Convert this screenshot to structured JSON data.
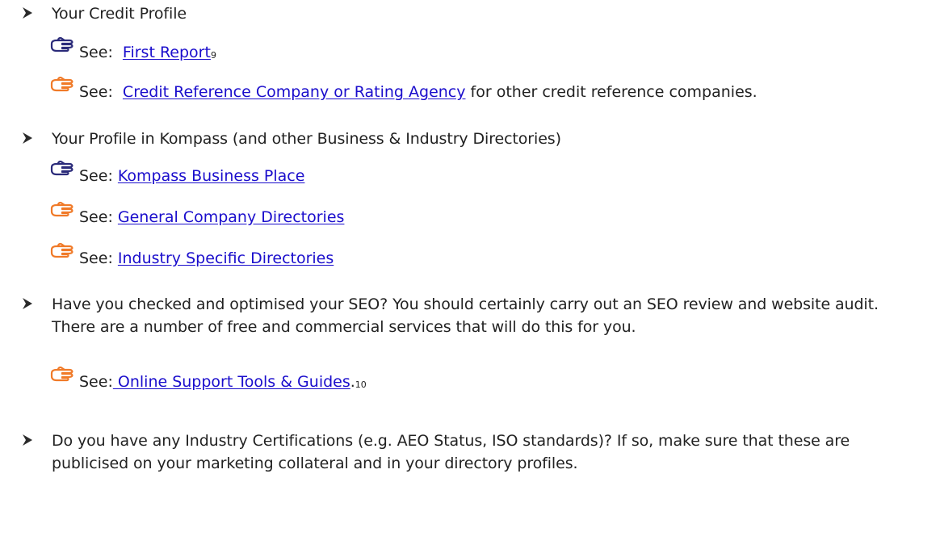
{
  "bullets": [
    {
      "text": "Your Credit Profile"
    },
    {
      "text": "Your Profile in Kompass (and other Business & Industry Directories)"
    },
    {
      "text": "Have you checked and optimised your SEO? You should certainly carry out an SEO review and website audit. There are a number of free and commercial services that will do this for you."
    },
    {
      "text": "Do you have any Industry Certifications (e.g. AEO Status, ISO standards)? If so, make sure that these are publicised on your marketing collateral and in your directory profiles."
    }
  ],
  "refs": [
    {
      "see": "See:  ",
      "link": "First Report",
      "sup": "9",
      "after": ""
    },
    {
      "see": "See:  ",
      "link": "Credit Reference Company or Rating Agency",
      "sup": "",
      "after": " for other credit reference companies."
    },
    {
      "see": "See: ",
      "link": "Kompass Business Place",
      "sup": "",
      "after": ""
    },
    {
      "see": "See: ",
      "link": "General Company Directories",
      "sup": "",
      "after": ""
    },
    {
      "see": "See: ",
      "link": "Industry Specific Directories",
      "sup": "",
      "after": ""
    },
    {
      "see": "See:",
      "link": " Online Support Tools & Guides",
      "sup": "10",
      "after": "."
    }
  ],
  "colors": {
    "link": "#1a0dcc",
    "hand_navy": "#2b2b7a",
    "hand_orange": "#f07a28",
    "text": "#222222"
  },
  "icons": [
    "arrow-bullet-icon",
    "pointing-hand-icon"
  ]
}
